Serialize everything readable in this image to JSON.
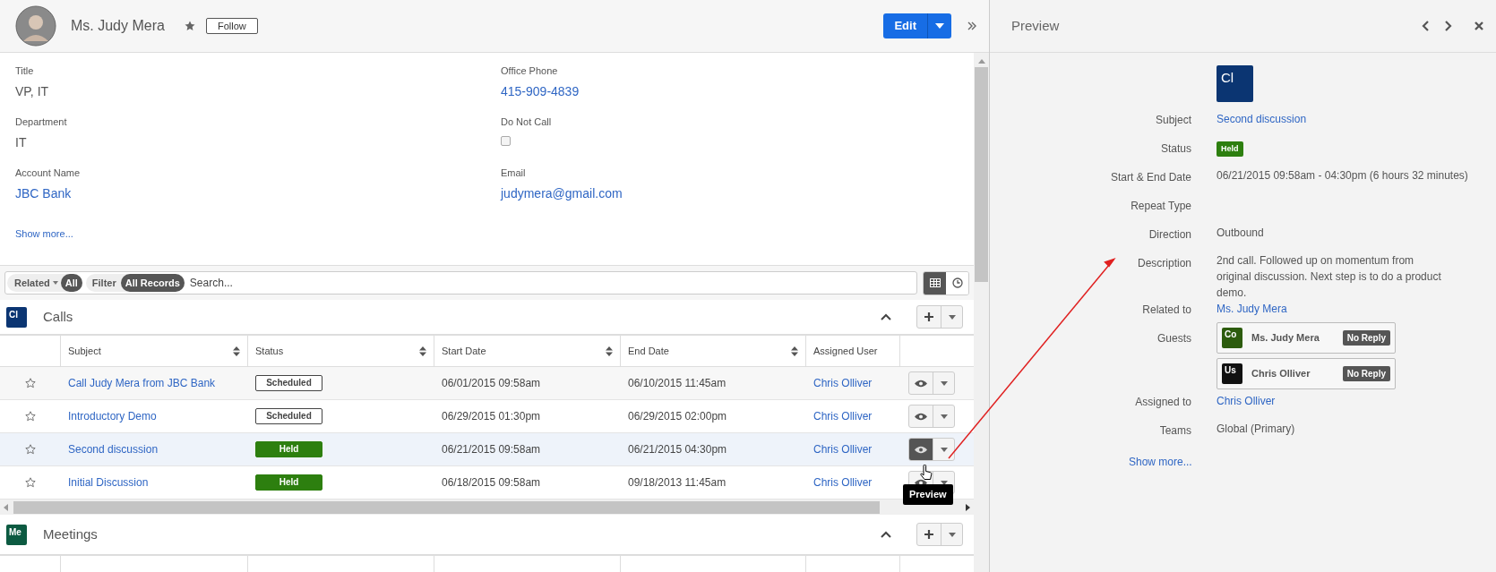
{
  "record": {
    "name": "Ms. Judy Mera",
    "follow": "Follow",
    "edit": "Edit"
  },
  "fields": [
    {
      "label": "Title",
      "value": "VP, IT",
      "kind": "text"
    },
    {
      "label": "Office Phone",
      "value": "415-909-4839",
      "kind": "link"
    },
    {
      "label": "Department",
      "value": "IT",
      "kind": "text"
    },
    {
      "label": "Do Not Call",
      "kind": "checkbox",
      "checked": false
    },
    {
      "label": "Account Name",
      "value": "JBC Bank",
      "kind": "link"
    },
    {
      "label": "Email",
      "value": "judymera@gmail.com",
      "kind": "link"
    }
  ],
  "show_more": "Show more...",
  "filter_bar": {
    "related": "Related",
    "related_value": "All",
    "filter": "Filter",
    "filter_value": "All Records",
    "search_placeholder": "Search...",
    "views": [
      {
        "kind": "list",
        "selected": true
      },
      {
        "kind": "timeline",
        "selected": false
      }
    ]
  },
  "calls": {
    "badge": "Cl",
    "title": "Calls",
    "expanded": true,
    "columns": [
      "Subject",
      "Status",
      "Start Date",
      "End Date",
      "Assigned User"
    ],
    "rows": [
      {
        "subject": "Call Judy Mera from JBC Bank",
        "status": "Scheduled",
        "kind": "scheduled",
        "start": "06/01/2015 09:58am",
        "end": "06/10/2015 11:45am",
        "assigned": "Chris Olliver",
        "selected": false
      },
      {
        "subject": "Introductory Demo",
        "status": "Scheduled",
        "kind": "scheduled",
        "start": "06/29/2015 01:30pm",
        "end": "06/29/2015 02:00pm",
        "assigned": "Chris Olliver",
        "selected": false
      },
      {
        "subject": "Second discussion",
        "status": "Held",
        "kind": "held",
        "start": "06/21/2015 09:58am",
        "end": "06/21/2015 04:30pm",
        "assigned": "Chris Olliver",
        "selected": true
      },
      {
        "subject": "Initial Discussion",
        "status": "Held",
        "kind": "held",
        "start": "06/18/2015 09:58am",
        "end": "09/18/2013 11:45am",
        "assigned": "Chris Olliver",
        "selected": false
      }
    ],
    "tooltip": "Preview"
  },
  "meetings": {
    "badge": "Me",
    "title": "Meetings",
    "expanded": true
  },
  "preview": {
    "title": "Preview",
    "badge": "Cl",
    "fields": [
      {
        "label": "Subject",
        "kind": "link",
        "value": "Second discussion"
      },
      {
        "label": "Status",
        "kind": "status",
        "value": "Held"
      },
      {
        "label": "Start & End Date",
        "kind": "text",
        "value": "06/21/2015 09:58am - 04:30pm (6 hours 32 minutes)"
      },
      {
        "label": "Repeat Type",
        "kind": "text"
      },
      {
        "label": "Direction",
        "kind": "text",
        "value": "Outbound"
      },
      {
        "label": "Description",
        "kind": "text",
        "value": "2nd call. Followed up on momentum from original discussion. Next step is to do a product demo."
      },
      {
        "label": "Related to",
        "kind": "link",
        "value": "Ms. Judy Mera"
      },
      {
        "label": "Guests",
        "kind": "guests",
        "guests": [
          {
            "badge": "Co",
            "color": "#2d5c0e",
            "name": "Ms. Judy Mera",
            "reply": "No Reply"
          },
          {
            "badge": "Us",
            "color": "#111111",
            "name": "Chris Olliver",
            "reply": "No Reply"
          }
        ]
      },
      {
        "label": "Assigned to",
        "kind": "link",
        "value": "Chris Olliver"
      },
      {
        "label": "Teams",
        "kind": "text",
        "value": "Global (Primary)"
      }
    ],
    "show_more": "Show more..."
  }
}
